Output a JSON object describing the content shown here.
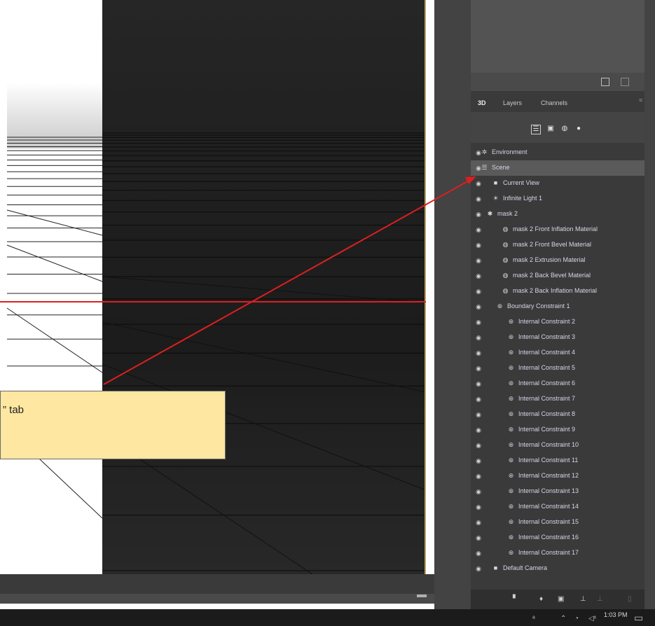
{
  "panel": {
    "tabs": [
      "3D",
      "Layers",
      "Channels"
    ],
    "filters": [
      "whole-scene-filter-icon",
      "meshes-filter-icon",
      "materials-filter-icon",
      "lights-filter-icon"
    ],
    "items": [
      {
        "label": "Environment",
        "icon": "environment-icon"
      },
      {
        "label": "Scene",
        "icon": "scene-icon",
        "selected": true
      },
      {
        "label": "Current View",
        "icon": "camera-icon"
      },
      {
        "label": "Infinite Light 1",
        "icon": "light-icon"
      },
      {
        "label": "mask 2",
        "icon": "mesh-icon"
      },
      {
        "label": "mask 2 Front Inflation Material",
        "icon": "material-icon"
      },
      {
        "label": "mask 2 Front Bevel Material",
        "icon": "material-icon"
      },
      {
        "label": "mask 2 Extrusion Material",
        "icon": "material-icon"
      },
      {
        "label": "mask 2 Back Bevel Material",
        "icon": "material-icon"
      },
      {
        "label": "mask 2 Back Inflation Material",
        "icon": "material-icon"
      },
      {
        "label": "Boundary Constraint 1",
        "icon": "constraint-icon"
      },
      {
        "label": "Internal Constraint 2",
        "icon": "constraint-icon"
      },
      {
        "label": "Internal Constraint 3",
        "icon": "constraint-icon"
      },
      {
        "label": "Internal Constraint 4",
        "icon": "constraint-icon"
      },
      {
        "label": "Internal Constraint 5",
        "icon": "constraint-icon"
      },
      {
        "label": "Internal Constraint 6",
        "icon": "constraint-icon"
      },
      {
        "label": "Internal Constraint 7",
        "icon": "constraint-icon"
      },
      {
        "label": "Internal Constraint 8",
        "icon": "constraint-icon"
      },
      {
        "label": "Internal Constraint 9",
        "icon": "constraint-icon"
      },
      {
        "label": "Internal Constraint 10",
        "icon": "constraint-icon"
      },
      {
        "label": "Internal Constraint 11",
        "icon": "constraint-icon"
      },
      {
        "label": "Internal Constraint 12",
        "icon": "constraint-icon"
      },
      {
        "label": "Internal Constraint 13",
        "icon": "constraint-icon"
      },
      {
        "label": "Internal Constraint 14",
        "icon": "constraint-icon"
      },
      {
        "label": "Internal Constraint 15",
        "icon": "constraint-icon"
      },
      {
        "label": "Internal Constraint 16",
        "icon": "constraint-icon"
      },
      {
        "label": "Internal Constraint 17",
        "icon": "constraint-icon"
      },
      {
        "label": "Default Camera",
        "icon": "camera-icon"
      }
    ],
    "bottom_icons": [
      "mesh-add-icon",
      "light-add-icon",
      "render-icon",
      "constraint-add-icon",
      "ground-icon",
      "trash-icon"
    ]
  },
  "callout": {
    "text": "” tab"
  },
  "taskbar": {
    "time": "1:03 PM"
  },
  "colors": {
    "panel_bg": "#3a3a3a",
    "selected_row": "#5a5a5a",
    "annotation_red": "#dd1f1f",
    "callout_bg": "#fde7a1",
    "viewport_border": "#b8a060"
  }
}
